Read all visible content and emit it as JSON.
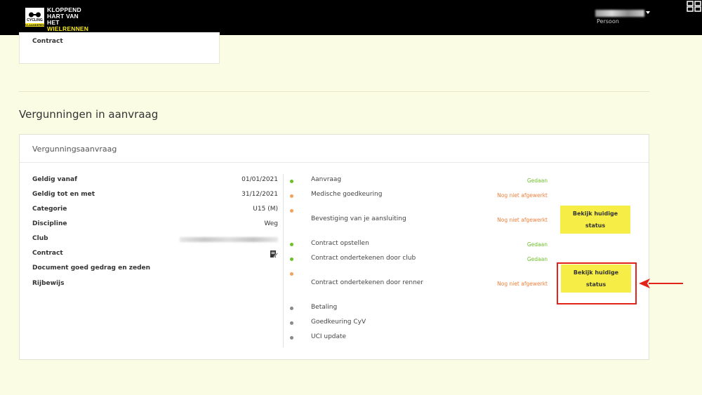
{
  "header": {
    "logo": {
      "badge_line1": "CYCLING",
      "badge_line2": "VLAANDEREN",
      "line1": "KLOPPEND",
      "line2": "HART VAN HET",
      "line3": "WIELRENNEN"
    },
    "user_role": "Persoon"
  },
  "top_card": {
    "label": "Contract"
  },
  "section_title": "Vergunningen in aanvraag",
  "card": {
    "title": "Vergunningsaanvraag",
    "info": [
      {
        "label": "Geldig vanaf",
        "value": "01/01/2021"
      },
      {
        "label": "Geldig tot en met",
        "value": "31/12/2021"
      },
      {
        "label": "Categorie",
        "value": "U15 (M)"
      },
      {
        "label": "Discipline",
        "value": "Weg"
      },
      {
        "label": "Club",
        "value": ""
      },
      {
        "label": "Contract",
        "value": ""
      },
      {
        "label": "Document goed gedrag en zeden",
        "value": ""
      },
      {
        "label": "Rijbewijs",
        "value": ""
      }
    ],
    "steps": [
      {
        "label": "Aanvraag",
        "status": "Gedaan"
      },
      {
        "label": "Medische goedkeuring",
        "status": "Nog niet afgewerkt"
      },
      {
        "label": "Bevestiging van je aansluiting",
        "status": "Nog niet afgewerkt",
        "button": "Bekijk huidige status"
      },
      {
        "label": "Contract opstellen",
        "status": "Gedaan"
      },
      {
        "label": "Contract ondertekenen door club",
        "status": "Gedaan"
      },
      {
        "label": "Contract ondertekenen door renner",
        "status": "Nog niet afgewerkt",
        "button": "Bekijk huidige status"
      },
      {
        "label": "Betaling",
        "status": ""
      },
      {
        "label": "Goedkeuring CyV",
        "status": ""
      },
      {
        "label": "UCI update",
        "status": ""
      }
    ]
  },
  "colors": {
    "done": "#6cbf29",
    "todo": "#f0803c",
    "pending": "#8a8a8a",
    "button": "#f6ee47",
    "highlight": "#e2231a",
    "page_bg": "#fbfce4"
  },
  "icons": {
    "apps": "grid-icon",
    "contract": "sign-document-icon",
    "annotation": "red-arrow-icon"
  }
}
